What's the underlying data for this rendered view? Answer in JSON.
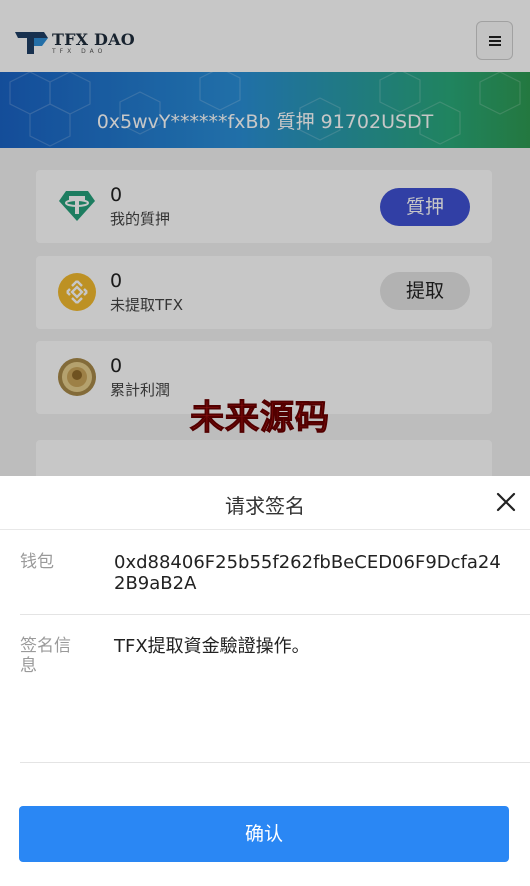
{
  "header": {
    "logo_name": "TFX DAO",
    "logo_sub": "TFX DAO",
    "menu_icon": "hamburger-menu-icon"
  },
  "banner": {
    "text": "0x5wvY******fxBb 質押 91702USDT"
  },
  "cards": [
    {
      "icon": "tether-icon",
      "value": "0",
      "label": "我的質押",
      "button": "質押"
    },
    {
      "icon": "bnb-coin-icon",
      "value": "0",
      "label": "未提取TFX",
      "button": "提取"
    },
    {
      "icon": "gold-coin-icon",
      "value": "0",
      "label": "累計利潤"
    }
  ],
  "watermark": "未来源码",
  "modal": {
    "title": "请求签名",
    "wallet_label": "钱包",
    "wallet_value": "0xd88406F25b55f262fbBeCED06F9Dcfa242B9aB2A",
    "message_label": "签名信息",
    "message_value": "TFX提取資金驗證操作。",
    "confirm_label": "确认",
    "close_icon": "close-icon"
  },
  "colors": {
    "stake_button": "#3f51d4",
    "confirm_button": "#2a87f4",
    "banner_start": "#1a63c5",
    "banner_end": "#2e9a52",
    "watermark": "#c01818"
  }
}
